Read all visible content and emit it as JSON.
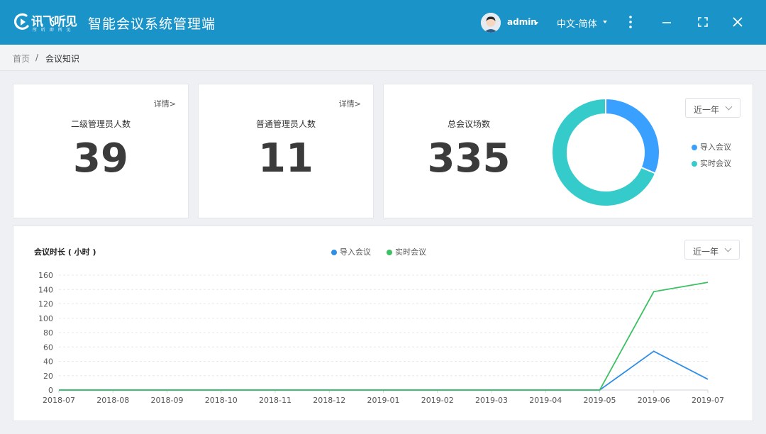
{
  "header": {
    "logo_name": "讯飞听见",
    "logo_sub": "所 听 即 所 见",
    "app_title": "智能会议系统管理端",
    "user": "admin",
    "language": "中文-简体"
  },
  "breadcrumb": {
    "home": "首页",
    "separator": "/",
    "current": "会议知识"
  },
  "stats": [
    {
      "label": "二级管理员人数",
      "value": "39",
      "more": "详情>"
    },
    {
      "label": "普通管理员人数",
      "value": "11",
      "more": "详情>"
    },
    {
      "label": "总会议场数",
      "value": "335"
    }
  ],
  "range": {
    "donut": "近一年",
    "line": "近一年"
  },
  "legend": {
    "imported": "导入会议",
    "live": "实时会议"
  },
  "colors": {
    "header": "#1a93c9",
    "imported": "#3aa0ff",
    "live": "#36cbcb",
    "line_imported": "#2f8ee6",
    "line_live": "#3cc063"
  },
  "chart_data": [
    {
      "type": "pie",
      "variant": "donut",
      "categories": [
        "导入会议",
        "实时会议"
      ],
      "values": [
        105,
        230
      ],
      "legend": "right"
    },
    {
      "type": "line",
      "title": "会议时长 ( 小时 )",
      "categories": [
        "2018-07",
        "2018-08",
        "2018-09",
        "2018-10",
        "2018-11",
        "2018-12",
        "2019-01",
        "2019-02",
        "2019-03",
        "2019-04",
        "2019-05",
        "2019-06",
        "2019-07"
      ],
      "series": [
        {
          "name": "导入会议",
          "values": [
            0,
            0,
            0,
            0,
            0,
            0,
            0,
            0,
            0,
            0,
            0,
            54,
            15
          ]
        },
        {
          "name": "实时会议",
          "values": [
            0,
            0,
            0,
            0,
            0,
            0,
            0,
            0,
            0,
            0,
            0,
            137,
            150
          ]
        }
      ],
      "ylim": [
        0,
        160
      ],
      "yticks": [
        0,
        20,
        40,
        60,
        80,
        100,
        120,
        140,
        160
      ],
      "grid": true,
      "legend": "top-center"
    }
  ]
}
